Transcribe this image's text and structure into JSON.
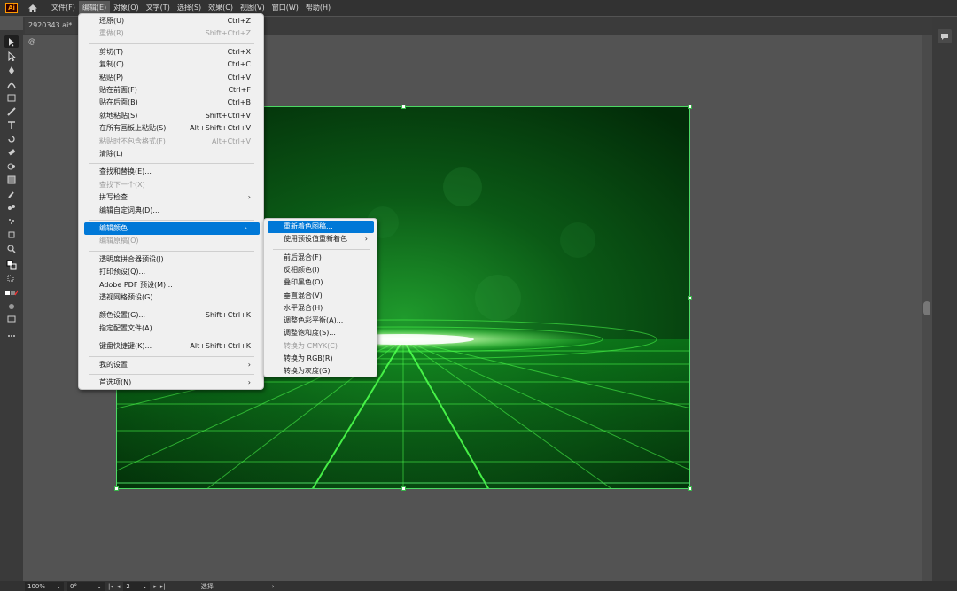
{
  "app": {
    "logo": "Ai",
    "document_tab": "2920343.ai* @"
  },
  "menubar": [
    "文件(F)",
    "编辑(E)",
    "对象(O)",
    "文字(T)",
    "选择(S)",
    "效果(C)",
    "视图(V)",
    "窗口(W)",
    "帮助(H)"
  ],
  "edit_menu": [
    {
      "label": "还原(U)",
      "shortcut": "Ctrl+Z",
      "disabled": false
    },
    {
      "label": "重做(R)",
      "shortcut": "Shift+Ctrl+Z",
      "disabled": true
    },
    {
      "sep": true
    },
    {
      "label": "剪切(T)",
      "shortcut": "Ctrl+X",
      "disabled": false
    },
    {
      "label": "复制(C)",
      "shortcut": "Ctrl+C",
      "disabled": false
    },
    {
      "label": "粘贴(P)",
      "shortcut": "Ctrl+V",
      "disabled": false
    },
    {
      "label": "贴在前面(F)",
      "shortcut": "Ctrl+F",
      "disabled": false
    },
    {
      "label": "贴在后面(B)",
      "shortcut": "Ctrl+B",
      "disabled": false
    },
    {
      "label": "就地粘贴(S)",
      "shortcut": "Shift+Ctrl+V",
      "disabled": false
    },
    {
      "label": "在所有画板上粘贴(S)",
      "shortcut": "Alt+Shift+Ctrl+V",
      "disabled": false
    },
    {
      "label": "粘贴时不包含格式(F)",
      "shortcut": "Alt+Ctrl+V",
      "disabled": true
    },
    {
      "label": "清除(L)",
      "shortcut": "",
      "disabled": false
    },
    {
      "sep": true
    },
    {
      "label": "查找和替换(E)...",
      "shortcut": "",
      "disabled": false
    },
    {
      "label": "查找下一个(X)",
      "shortcut": "",
      "disabled": true
    },
    {
      "label": "拼写检查",
      "shortcut": "",
      "submenu": true,
      "disabled": false
    },
    {
      "label": "编辑自定词典(D)...",
      "shortcut": "",
      "disabled": false
    },
    {
      "sep": true
    },
    {
      "label": "编辑颜色",
      "shortcut": "",
      "submenu": true,
      "highlight": true
    },
    {
      "label": "编辑原稿(O)",
      "shortcut": "",
      "disabled": true
    },
    {
      "sep": true
    },
    {
      "label": "透明度拼合器预设(J)...",
      "shortcut": "",
      "disabled": false
    },
    {
      "label": "打印预设(Q)...",
      "shortcut": "",
      "disabled": false
    },
    {
      "label": "Adobe PDF 预设(M)...",
      "shortcut": "",
      "disabled": false
    },
    {
      "label": "透视网格预设(G)...",
      "shortcut": "",
      "disabled": false
    },
    {
      "sep": true
    },
    {
      "label": "颜色设置(G)...",
      "shortcut": "Shift+Ctrl+K",
      "disabled": false
    },
    {
      "label": "指定配置文件(A)...",
      "shortcut": "",
      "disabled": false
    },
    {
      "sep": true
    },
    {
      "label": "键盘快捷键(K)...",
      "shortcut": "Alt+Shift+Ctrl+K",
      "disabled": false
    },
    {
      "sep": true
    },
    {
      "label": "我的设置",
      "shortcut": "",
      "submenu": true,
      "disabled": false
    },
    {
      "sep": true
    },
    {
      "label": "首选项(N)",
      "shortcut": "",
      "submenu": true,
      "disabled": false
    }
  ],
  "color_submenu": [
    {
      "label": "重新着色图稿...",
      "highlight": true
    },
    {
      "label": "使用预设值重新着色",
      "submenu": true
    },
    {
      "sep": true
    },
    {
      "label": "前后混合(F)"
    },
    {
      "label": "反相颜色(I)"
    },
    {
      "label": "叠印黑色(O)..."
    },
    {
      "label": "垂直混合(V)"
    },
    {
      "label": "水平混合(H)"
    },
    {
      "label": "调整色彩平衡(A)..."
    },
    {
      "label": "调整饱和度(S)..."
    },
    {
      "label": "转换为 CMYK(C)",
      "disabled": true
    },
    {
      "label": "转换为 RGB(R)"
    },
    {
      "label": "转换为灰度(G)"
    }
  ],
  "statusbar": {
    "zoom": "100%",
    "rotation": "0°",
    "artboard": "2",
    "tool": "选择"
  },
  "colors": {
    "menu_highlight": "#0078d7",
    "artboard_border": "#4cd964"
  }
}
